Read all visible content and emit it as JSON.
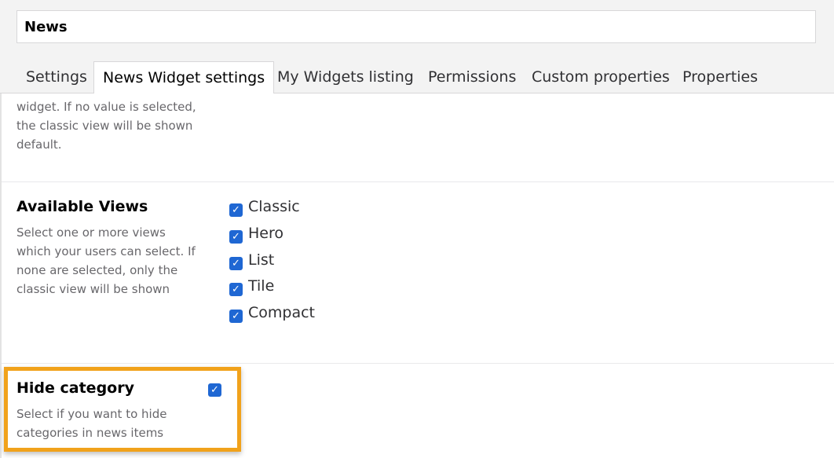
{
  "header": {
    "name_value": "News"
  },
  "tabs": [
    {
      "label": "Settings"
    },
    {
      "label": "News Widget settings"
    },
    {
      "label": "My Widgets listing"
    },
    {
      "label": "Permissions"
    },
    {
      "label": "Custom properties"
    },
    {
      "label": "Properties"
    }
  ],
  "active_tab": "News Widget settings",
  "default_view": {
    "desc_lines": [
      "widget. If no value is selected,",
      "the classic view will be shown",
      "default."
    ]
  },
  "available_views": {
    "label": "Available Views",
    "desc_lines": [
      "Select one or more views",
      "which your users can select. If",
      "none are selected, only the",
      "classic view will be shown"
    ],
    "options": [
      {
        "label": "Classic",
        "checked": true
      },
      {
        "label": "Hero",
        "checked": true
      },
      {
        "label": "List",
        "checked": true
      },
      {
        "label": "Tile",
        "checked": true
      },
      {
        "label": "Compact",
        "checked": true
      }
    ]
  },
  "hide_category": {
    "label": "Hide category",
    "checked": true,
    "desc_lines": [
      "Select if you want to hide",
      "categories in news items"
    ]
  },
  "colors": {
    "accent": "#1f67d3",
    "highlight": "#f1a21b",
    "text": "#1b264f"
  }
}
